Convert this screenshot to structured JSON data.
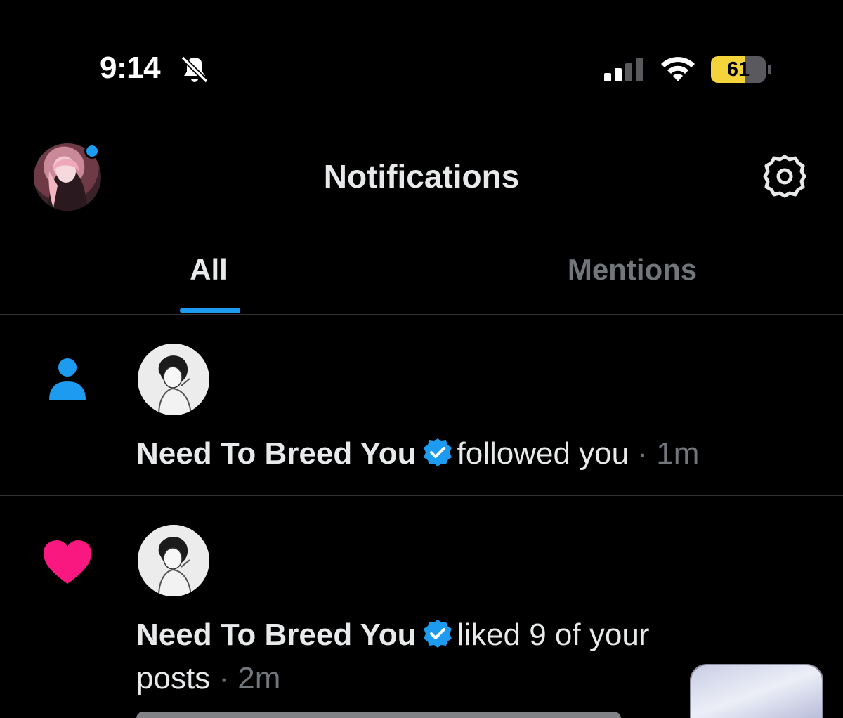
{
  "status_bar": {
    "time": "9:14",
    "battery_percent": "61",
    "battery_level": 0.61,
    "icons": [
      "bell-slash-icon",
      "signal-icon",
      "wifi-icon",
      "battery-icon"
    ]
  },
  "header": {
    "title": "Notifications",
    "has_unread_dot": true,
    "settings_icon": "gear-icon"
  },
  "tabs": [
    {
      "label": "All",
      "selected": true
    },
    {
      "label": "Mentions",
      "selected": false
    }
  ],
  "notifications": [
    {
      "type_icon": "person-icon",
      "user": "Need To Breed You",
      "verified": true,
      "action": "followed you",
      "separator": "·",
      "time": "1m"
    },
    {
      "type_icon": "heart-icon",
      "user": "Need To Breed You",
      "verified": true,
      "action": "liked 9 of your posts",
      "separator": "·",
      "time": "2m"
    }
  ],
  "colors": {
    "background": "#000000",
    "accent": "#1d9bf0",
    "like": "#f91880",
    "muted_text": "#71767b",
    "battery": "#f5d33b"
  }
}
